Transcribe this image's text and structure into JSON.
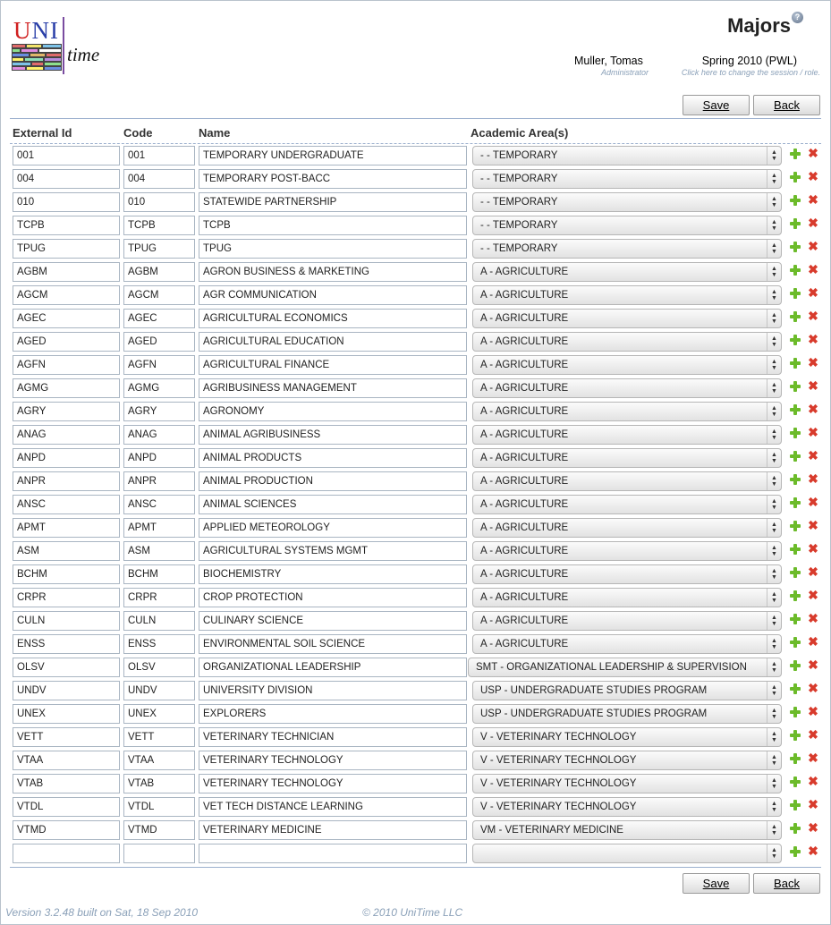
{
  "app": {
    "logo_text_uni_u": "U",
    "logo_text_uni_ni": "NI",
    "logo_text_time": "time"
  },
  "header": {
    "page_title": "Majors",
    "help_icon": "?",
    "user_name": "Muller, Tomas",
    "user_role": "Administrator",
    "session_name": "Spring 2010 (PWL)",
    "session_hint": "Click here to change the session / role."
  },
  "buttons": {
    "save": "Save",
    "back": "Back"
  },
  "columns": {
    "external_id": "External Id",
    "code": "Code",
    "name": "Name",
    "academic_areas": "Academic Area(s)"
  },
  "icons": {
    "add": "plus-icon",
    "delete": "delete-icon",
    "delete_glyph": "✖"
  },
  "colors": {
    "add_green": "#6cbb2a",
    "delete_red": "#d83b2c",
    "accent_blue": "#9cb0ce"
  },
  "rows": [
    {
      "ext": "001",
      "code": "001",
      "name": "TEMPORARY UNDERGRADUATE",
      "area": "- - TEMPORARY"
    },
    {
      "ext": "004",
      "code": "004",
      "name": "TEMPORARY POST-BACC",
      "area": "- - TEMPORARY"
    },
    {
      "ext": "010",
      "code": "010",
      "name": "STATEWIDE PARTNERSHIP",
      "area": "- - TEMPORARY"
    },
    {
      "ext": "TCPB",
      "code": "TCPB",
      "name": "TCPB",
      "area": "- - TEMPORARY"
    },
    {
      "ext": "TPUG",
      "code": "TPUG",
      "name": "TPUG",
      "area": "- - TEMPORARY"
    },
    {
      "ext": "AGBM",
      "code": "AGBM",
      "name": "AGRON BUSINESS & MARKETING",
      "area": "A - AGRICULTURE"
    },
    {
      "ext": "AGCM",
      "code": "AGCM",
      "name": "AGR COMMUNICATION",
      "area": "A - AGRICULTURE"
    },
    {
      "ext": "AGEC",
      "code": "AGEC",
      "name": "AGRICULTURAL ECONOMICS",
      "area": "A - AGRICULTURE"
    },
    {
      "ext": "AGED",
      "code": "AGED",
      "name": "AGRICULTURAL EDUCATION",
      "area": "A - AGRICULTURE"
    },
    {
      "ext": "AGFN",
      "code": "AGFN",
      "name": "AGRICULTURAL FINANCE",
      "area": "A - AGRICULTURE"
    },
    {
      "ext": "AGMG",
      "code": "AGMG",
      "name": "AGRIBUSINESS MANAGEMENT",
      "area": "A - AGRICULTURE"
    },
    {
      "ext": "AGRY",
      "code": "AGRY",
      "name": "AGRONOMY",
      "area": "A - AGRICULTURE"
    },
    {
      "ext": "ANAG",
      "code": "ANAG",
      "name": "ANIMAL AGRIBUSINESS",
      "area": "A - AGRICULTURE"
    },
    {
      "ext": "ANPD",
      "code": "ANPD",
      "name": "ANIMAL PRODUCTS",
      "area": "A - AGRICULTURE"
    },
    {
      "ext": "ANPR",
      "code": "ANPR",
      "name": "ANIMAL PRODUCTION",
      "area": "A - AGRICULTURE"
    },
    {
      "ext": "ANSC",
      "code": "ANSC",
      "name": "ANIMAL SCIENCES",
      "area": "A - AGRICULTURE"
    },
    {
      "ext": "APMT",
      "code": "APMT",
      "name": "APPLIED METEOROLOGY",
      "area": "A - AGRICULTURE"
    },
    {
      "ext": "ASM",
      "code": "ASM",
      "name": "AGRICULTURAL SYSTEMS MGMT",
      "area": "A - AGRICULTURE"
    },
    {
      "ext": "BCHM",
      "code": "BCHM",
      "name": "BIOCHEMISTRY",
      "area": "A - AGRICULTURE"
    },
    {
      "ext": "CRPR",
      "code": "CRPR",
      "name": "CROP PROTECTION",
      "area": "A - AGRICULTURE"
    },
    {
      "ext": "CULN",
      "code": "CULN",
      "name": "CULINARY SCIENCE",
      "area": "A - AGRICULTURE"
    },
    {
      "ext": "ENSS",
      "code": "ENSS",
      "name": "ENVIRONMENTAL SOIL SCIENCE",
      "area": "A - AGRICULTURE"
    },
    {
      "ext": "OLSV",
      "code": "OLSV",
      "name": "ORGANIZATIONAL LEADERSHIP",
      "area": "SMT - ORGANIZATIONAL LEADERSHIP & SUPERVISION"
    },
    {
      "ext": "UNDV",
      "code": "UNDV",
      "name": "UNIVERSITY DIVISION",
      "area": "USP - UNDERGRADUATE STUDIES PROGRAM"
    },
    {
      "ext": "UNEX",
      "code": "UNEX",
      "name": "EXPLORERS",
      "area": "USP - UNDERGRADUATE STUDIES PROGRAM"
    },
    {
      "ext": "VETT",
      "code": "VETT",
      "name": "VETERINARY TECHNICIAN",
      "area": "V - VETERINARY TECHNOLOGY"
    },
    {
      "ext": "VTAA",
      "code": "VTAA",
      "name": "VETERINARY TECHNOLOGY",
      "area": "V - VETERINARY TECHNOLOGY"
    },
    {
      "ext": "VTAB",
      "code": "VTAB",
      "name": "VETERINARY TECHNOLOGY",
      "area": "V - VETERINARY TECHNOLOGY"
    },
    {
      "ext": "VTDL",
      "code": "VTDL",
      "name": "VET TECH DISTANCE LEARNING",
      "area": "V - VETERINARY TECHNOLOGY"
    },
    {
      "ext": "VTMD",
      "code": "VTMD",
      "name": "VETERINARY MEDICINE",
      "area": "VM - VETERINARY MEDICINE"
    },
    {
      "ext": "",
      "code": "",
      "name": "",
      "area": ""
    }
  ],
  "footer": {
    "version": "Version 3.2.48 built on Sat, 18 Sep 2010",
    "copyright": "© 2010 UniTime LLC"
  }
}
